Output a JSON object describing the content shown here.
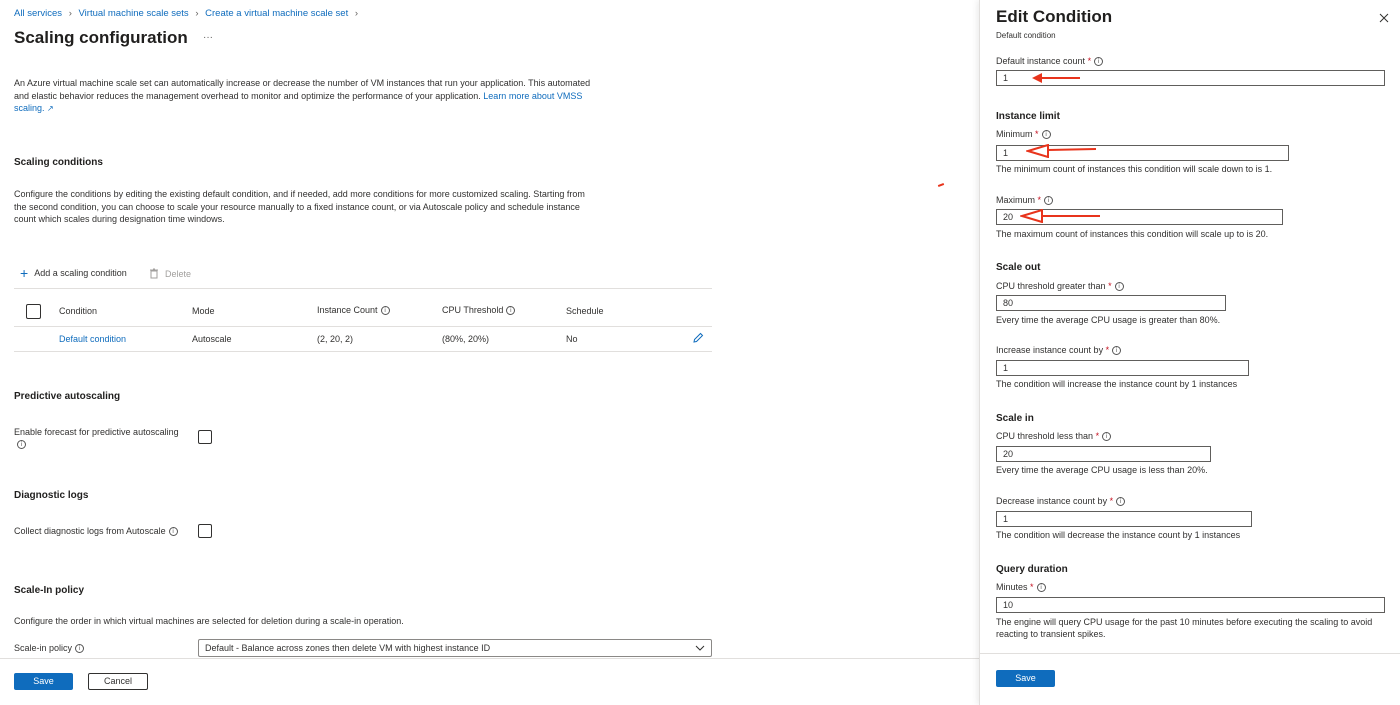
{
  "breadcrumb": [
    "All services",
    "Virtual machine scale sets",
    "Create a virtual machine scale set"
  ],
  "page": {
    "title": "Scaling configuration",
    "more": "···",
    "intro": "An Azure virtual machine scale set can automatically increase or decrease the number of VM instances that run your application. This automated and elastic behavior reduces the management overhead to monitor and optimize the performance of your application.",
    "intro_link": "Learn more about VMSS scaling.",
    "scaling_conditions_title": "Scaling conditions",
    "scaling_conditions_desc": "Configure the conditions by editing the existing default condition, and if needed, add more conditions for more customized scaling. Starting from the second condition, you can choose to scale your resource manually to a fixed instance count, or via Autoscale policy and schedule instance count which scales during designation time windows.",
    "add_condition": "Add a scaling condition",
    "delete": "Delete",
    "table": {
      "headers": [
        "Condition",
        "Mode",
        "Instance Count",
        "CPU Threshold",
        "Schedule"
      ],
      "rows": [
        [
          "Default condition",
          "Autoscale",
          "(2, 20, 2)",
          "(80%, 20%)",
          "No"
        ]
      ]
    },
    "predictive_title": "Predictive autoscaling",
    "predictive_label": "Enable forecast for predictive autoscaling",
    "diagnostic_title": "Diagnostic logs",
    "diagnostic_label": "Collect diagnostic logs from Autoscale",
    "scalein_title": "Scale-In policy",
    "scalein_desc": "Configure the order in which virtual machines are selected for deletion during a scale-in operation.",
    "scalein_label": "Scale-in policy",
    "scalein_value": "Default - Balance across zones then delete VM with highest instance ID",
    "save": "Save",
    "cancel": "Cancel"
  },
  "panel": {
    "title": "Edit Condition",
    "subtitle": "Default condition",
    "default_count_label": "Default instance count",
    "default_count_value": "1",
    "instance_limit_title": "Instance limit",
    "minimum_label": "Minimum",
    "minimum_value": "1",
    "minimum_desc": "The minimum count of instances this condition will scale down to is 1.",
    "maximum_label": "Maximum",
    "maximum_value": "20",
    "maximum_desc": "The maximum count of instances this condition will scale up to is 20.",
    "scale_out_title": "Scale out",
    "cpu_greater_label": "CPU threshold greater than",
    "cpu_greater_value": "80",
    "cpu_greater_desc": "Every time the average CPU usage is greater than 80%.",
    "increase_label": "Increase instance count by",
    "increase_value": "1",
    "increase_desc": "The condition will increase the instance count by 1 instances",
    "scale_in_title": "Scale in",
    "cpu_less_label": "CPU threshold less than",
    "cpu_less_value": "20",
    "cpu_less_desc": "Every time the average CPU usage is less than 20%.",
    "decrease_label": "Decrease instance count by",
    "decrease_value": "1",
    "decrease_desc": "The condition will decrease the instance count by 1 instances",
    "query_title": "Query duration",
    "minutes_label": "Minutes",
    "minutes_value": "10",
    "minutes_desc": "The engine will query CPU usage for the past 10 minutes before executing the scaling to avoid reacting to transient spikes.",
    "save": "Save"
  },
  "colors": {
    "accent": "#0f6cbd",
    "annotation": "#e8341c"
  }
}
